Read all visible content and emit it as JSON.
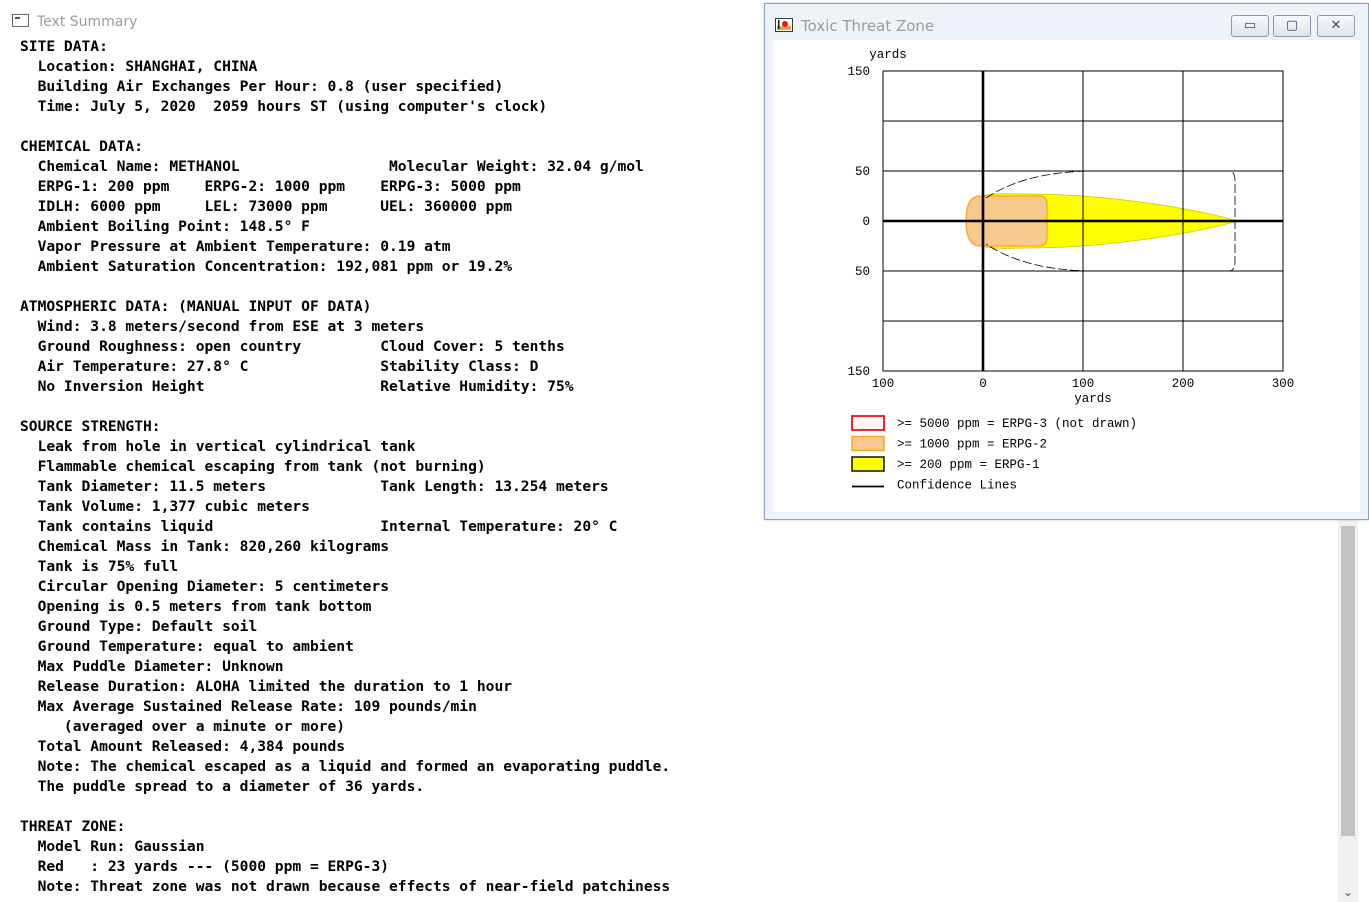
{
  "text_summary": {
    "title": "Text Summary",
    "lines": [
      "SITE DATA:",
      "  Location: SHANGHAI, CHINA",
      "  Building Air Exchanges Per Hour: 0.8 (user specified)",
      "  Time: July 5, 2020  2059 hours ST (using computer's clock)",
      "",
      "CHEMICAL DATA:",
      "  Chemical Name: METHANOL                 Molecular Weight: 32.04 g/mol",
      "  ERPG-1: 200 ppm    ERPG-2: 1000 ppm    ERPG-3: 5000 ppm",
      "  IDLH: 6000 ppm     LEL: 73000 ppm      UEL: 360000 ppm",
      "  Ambient Boiling Point: 148.5° F",
      "  Vapor Pressure at Ambient Temperature: 0.19 atm",
      "  Ambient Saturation Concentration: 192,081 ppm or 19.2%",
      "",
      "ATMOSPHERIC DATA: (MANUAL INPUT OF DATA)",
      "  Wind: 3.8 meters/second from ESE at 3 meters",
      "  Ground Roughness: open country         Cloud Cover: 5 tenths",
      "  Air Temperature: 27.8° C               Stability Class: D",
      "  No Inversion Height                    Relative Humidity: 75%",
      "",
      "SOURCE STRENGTH:",
      "  Leak from hole in vertical cylindrical tank",
      "  Flammable chemical escaping from tank (not burning)",
      "  Tank Diameter: 11.5 meters             Tank Length: 13.254 meters",
      "  Tank Volume: 1,377 cubic meters",
      "  Tank contains liquid                   Internal Temperature: 20° C",
      "  Chemical Mass in Tank: 820,260 kilograms",
      "  Tank is 75% full",
      "  Circular Opening Diameter: 5 centimeters",
      "  Opening is 0.5 meters from tank bottom",
      "  Ground Type: Default soil",
      "  Ground Temperature: equal to ambient",
      "  Max Puddle Diameter: Unknown",
      "  Release Duration: ALOHA limited the duration to 1 hour",
      "  Max Average Sustained Release Rate: 109 pounds/min",
      "     (averaged over a minute or more)",
      "  Total Amount Released: 4,384 pounds",
      "  Note: The chemical escaped as a liquid and formed an evaporating puddle.",
      "  The puddle spread to a diameter of 36 yards.",
      "",
      "THREAT ZONE:",
      "  Model Run: Gaussian",
      "  Red   : 23 yards --- (5000 ppm = ERPG-3)",
      "  Note: Threat zone was not drawn because effects of near-field patchiness"
    ]
  },
  "threat_zone": {
    "title": "Toxic Threat Zone",
    "buttons": {
      "minimize": "▭",
      "maximize": "▢",
      "close": "✕"
    },
    "colors": {
      "erpg3_border": "#e8121b",
      "erpg2_fill": "#f7c98d",
      "erpg2_border": "#f5a623",
      "erpg1_fill": "#ffff00",
      "grid": "#000000"
    },
    "legend": [
      {
        "label": ">= 5000 ppm = ERPG-3 (not drawn)",
        "swatch": "erpg3"
      },
      {
        "label": ">= 1000 ppm = ERPG-2",
        "swatch": "erpg2"
      },
      {
        "label": ">= 200 ppm = ERPG-1",
        "swatch": "erpg1"
      },
      {
        "label": "Confidence Lines",
        "swatch": "line"
      }
    ],
    "chart_data": {
      "type": "area",
      "x_unit_label": "yards",
      "y_unit_label": "yards",
      "x_ticks": [
        "100",
        "0",
        "100",
        "200",
        "300"
      ],
      "y_ticks": [
        "150",
        "50",
        "0",
        "50",
        "150"
      ],
      "xlim": [
        -100,
        300
      ],
      "ylim": [
        -150,
        150
      ],
      "y_gridlines": [
        100,
        50,
        0,
        -50,
        -100
      ],
      "x_gridlines": [
        -100,
        0,
        100,
        200,
        300
      ],
      "zones": [
        {
          "name": ">= 1000 ppm = ERPG-2",
          "x_start": -17,
          "x_end": 62,
          "half_width": 25
        },
        {
          "name": ">= 200 ppm = ERPG-1",
          "x_start": -17,
          "x_end": 254,
          "half_width": 27
        }
      ],
      "confidence_half_width": 50,
      "confidence_x_end": 254
    }
  }
}
